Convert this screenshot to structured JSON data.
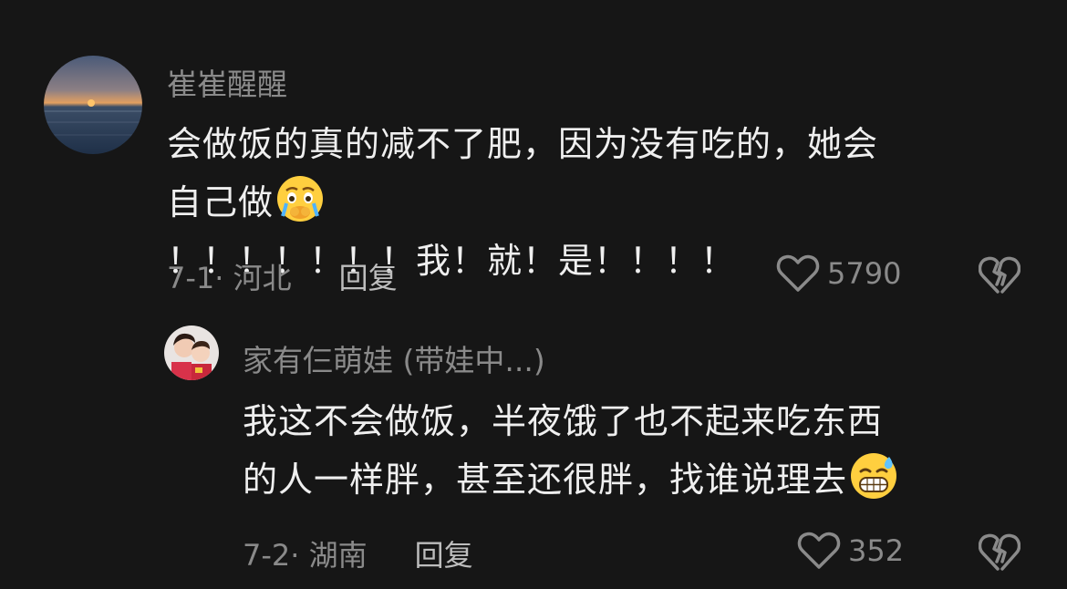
{
  "comments": [
    {
      "username": "崔崔醒醒",
      "lines": [
        "会做饭的真的减不了肥，因为没有吃的，她会",
        "自己做",
        "！！！！！！！我！就！是！！！！"
      ],
      "emoji": "crying-face-emoji",
      "date": "7-1",
      "location": "河北",
      "reply_label": "回复",
      "likes": "5790"
    },
    {
      "username": "家有仨萌娃 (带娃中...)",
      "lines": [
        "我这不会做饭，半夜饿了也不起来吃东西",
        "的人一样胖，甚至还很胖，找谁说理去"
      ],
      "emoji": "grinning-sweat-emoji",
      "date": "7-2",
      "location": "湖南",
      "reply_label": "回复",
      "likes": "352"
    }
  ],
  "colors": {
    "background": "#161616",
    "text": "#efefef",
    "muted": "#8a8a8a"
  },
  "icons": [
    "heart-icon",
    "broken-heart-icon"
  ]
}
